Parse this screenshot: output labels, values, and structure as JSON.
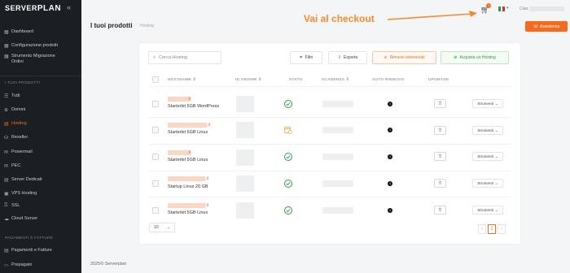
{
  "brand": {
    "server": "SERVER",
    "plan": "PLAN",
    "collapse_icon": "«"
  },
  "sidebar": {
    "items": [
      {
        "label": "Dashboard",
        "icon": "grid-icon"
      },
      {
        "label": "Configurazione prodotti",
        "icon": "grid-icon"
      },
      {
        "label": "Strumento Migrazione",
        "label2": "Ordini",
        "icon": "grid-icon"
      }
    ],
    "section_products": "I TUOI PRODOTTI",
    "products": [
      {
        "label": "Tutti",
        "icon": "list-icon"
      },
      {
        "label": "Domini",
        "icon": "globe-icon"
      },
      {
        "label": "Hosting",
        "icon": "server-icon",
        "active": true
      },
      {
        "label": "Reseller",
        "icon": "reseller-icon"
      },
      {
        "label": "Powermail",
        "icon": "mail-icon"
      },
      {
        "label": "PEC",
        "icon": "pec-icon"
      },
      {
        "label": "Server Dedicati",
        "icon": "server-icon"
      },
      {
        "label": "VPS Hosting",
        "icon": "vps-icon"
      },
      {
        "label": "SSL",
        "icon": "lock-icon"
      },
      {
        "label": "Cloud Server",
        "icon": "cloud-icon"
      }
    ],
    "section_payments": "PAGAMENTI E FATTURE",
    "payments": [
      {
        "label": "Pagamenti e Fatture",
        "icon": "invoice-icon"
      },
      {
        "label": "Prepagato",
        "icon": "wallet-icon"
      }
    ]
  },
  "header": {
    "title": "I tuoi prodotti",
    "breadcrumb": "Hosting",
    "annotation": "Vai al checkout",
    "cart_count": "1",
    "greeting": "Ciao,",
    "assist_label": "Assistenza"
  },
  "toolbar": {
    "search_placeholder": "Cerca Hosting",
    "filter_label": "Filtri",
    "export_label": "Esporta",
    "remove_label": "Rimuovi selezionati",
    "add_label": "Acquista un Hosting"
  },
  "table": {
    "headers": {
      "hostname": "HOSTNAME ⇕",
      "order_id": "ID ORDINE ⇕",
      "status": "STATO",
      "expiry": "SCADENZA ⇕",
      "auto_renew": "AUTO RINNOVO",
      "upgrade": "UPGRADE"
    },
    "rows": [
      {
        "tld": ".it",
        "plan": "Starterkit 5GB WordPress",
        "status": "active"
      },
      {
        "tld": ".it",
        "plan": "Starterkit 5GB Linux",
        "status": "pending"
      },
      {
        "tld": ".it",
        "plan": "Starterkit 5GB Linux",
        "status": "active"
      },
      {
        "tld": ".it",
        "plan": "Startup Linux 20 GB",
        "status": "active"
      },
      {
        "tld": ".it",
        "plan": "Starterkit 5GB Linux",
        "status": "active"
      }
    ],
    "tools_label": "Strumenti",
    "info_glyph": "i"
  },
  "pagination": {
    "page_size": "10",
    "prev": "‹",
    "current": "1",
    "next": "›"
  },
  "footer": "2025© Serverplan",
  "colors": {
    "accent": "#f26b1f",
    "success": "#2e9e48",
    "sidebar_bg": "#1b1e23"
  }
}
